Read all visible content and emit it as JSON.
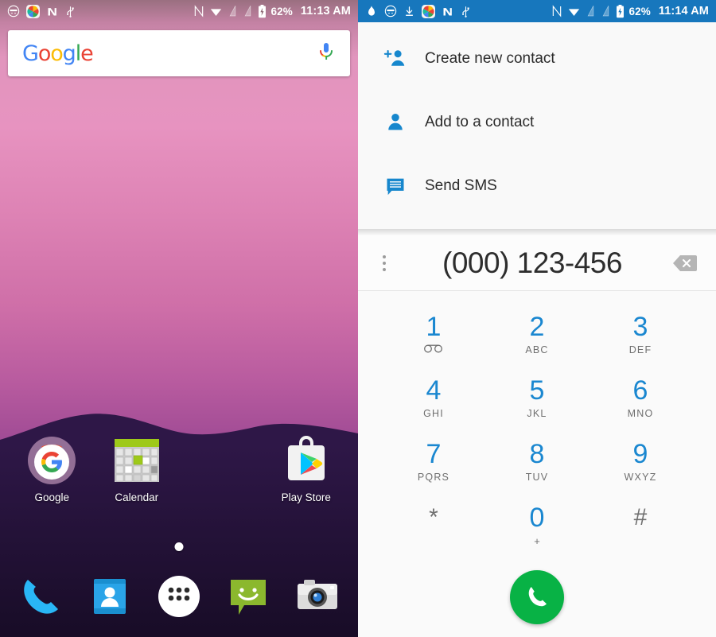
{
  "home": {
    "status_bar": {
      "time": "11:13 AM",
      "battery": "62%",
      "left_icons": [
        "smiley-face-icon",
        "photos-icon",
        "nova-icon",
        "usb-icon"
      ],
      "right_icons": [
        "nfc-icon",
        "wifi-icon",
        "sim-card-1-icon",
        "sim-card-2-icon",
        "battery-charging-icon"
      ],
      "background_color": "#7e5a66"
    },
    "search": {
      "logo_text": "Google",
      "logo_letters": [
        "G",
        "o",
        "o",
        "g",
        "l",
        "e"
      ],
      "logo_colors": [
        "#4285F4",
        "#EA4335",
        "#FBBC05",
        "#4285F4",
        "#34A853",
        "#EA4335"
      ],
      "mic_icon": "microphone-icon"
    },
    "apps": [
      {
        "label": "Google",
        "icon": "google-app-icon"
      },
      {
        "label": "Calendar",
        "icon": "calendar-app-icon"
      },
      {
        "label": "",
        "icon": ""
      },
      {
        "label": "Play Store",
        "icon": "play-store-app-icon"
      }
    ],
    "page_indicator": {
      "pages": 1,
      "current": 1
    },
    "dock": [
      {
        "label": "Phone",
        "icon": "phone-dock-icon"
      },
      {
        "label": "Contacts",
        "icon": "contacts-dock-icon"
      },
      {
        "label": "All apps",
        "icon": "app-drawer-icon"
      },
      {
        "label": "Messaging",
        "icon": "messaging-dock-icon"
      },
      {
        "label": "Camera",
        "icon": "camera-dock-icon"
      }
    ],
    "wallpaper_colors": [
      "#e195bd",
      "#cf6fa8",
      "#82398a",
      "#2e1747"
    ]
  },
  "dialer": {
    "status_bar": {
      "time": "11:14 AM",
      "battery": "62%",
      "left_icons": [
        "flame-icon",
        "smiley-face-icon",
        "download-icon",
        "photos-icon",
        "nova-icon",
        "usb-icon"
      ],
      "right_icons": [
        "nfc-icon",
        "wifi-icon",
        "sim-card-1-icon",
        "sim-card-2-icon",
        "battery-charging-icon"
      ],
      "background_color": "#1777bd"
    },
    "menu": {
      "items": [
        {
          "label": "Create new contact",
          "icon": "person-add-icon"
        },
        {
          "label": "Add to a contact",
          "icon": "person-icon"
        },
        {
          "label": "Send SMS",
          "icon": "message-icon"
        }
      ],
      "accent_color": "#1787cd"
    },
    "number_field": {
      "value": "(000) 123-456",
      "overflow_icon": "more-vert-icon",
      "backspace_icon": "backspace-icon"
    },
    "keypad": {
      "keys": [
        {
          "digit": "1",
          "letters": "",
          "sub_icon": "voicemail-icon"
        },
        {
          "digit": "2",
          "letters": "ABC",
          "sub_icon": ""
        },
        {
          "digit": "3",
          "letters": "DEF",
          "sub_icon": ""
        },
        {
          "digit": "4",
          "letters": "GHI",
          "sub_icon": ""
        },
        {
          "digit": "5",
          "letters": "JKL",
          "sub_icon": ""
        },
        {
          "digit": "6",
          "letters": "MNO",
          "sub_icon": ""
        },
        {
          "digit": "7",
          "letters": "PQRS",
          "sub_icon": ""
        },
        {
          "digit": "8",
          "letters": "TUV",
          "sub_icon": ""
        },
        {
          "digit": "9",
          "letters": "WXYZ",
          "sub_icon": ""
        },
        {
          "digit": "*",
          "letters": "",
          "sub_icon": ""
        },
        {
          "digit": "0",
          "letters": "+",
          "sub_icon": ""
        },
        {
          "digit": "#",
          "letters": "",
          "sub_icon": ""
        }
      ],
      "digit_color": "#1a87d0"
    },
    "call_button": {
      "icon": "phone-call-icon",
      "color": "#08b245"
    }
  }
}
